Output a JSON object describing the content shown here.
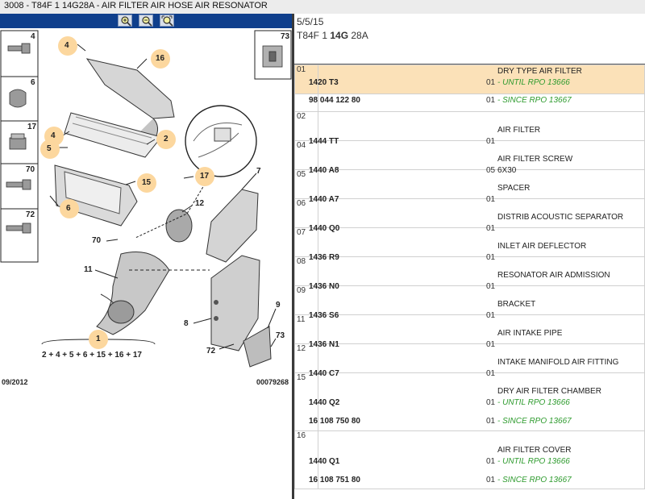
{
  "window": {
    "title": "3008 - T84F 1 14G28A - AIR FILTER AIR HOSE AIR RESONATOR"
  },
  "toolbar": {
    "buttons": [
      "zoom-in-icon",
      "zoom-out-icon",
      "zoom-fit-icon"
    ]
  },
  "header": {
    "date": "5/5/15",
    "code_prefix": "T84F 1 ",
    "code_bold": "14G",
    "code_suffix": " 28A"
  },
  "diagram": {
    "date": "09/2012",
    "ref": "00079268",
    "formula": "2 + 4 + 5 + 6 + 15 + 16 + 17",
    "side_labels": [
      "4",
      "6",
      "17",
      "70",
      "72"
    ],
    "side_right_label": "73",
    "callouts": [
      "4",
      "16",
      "2",
      "4",
      "5",
      "15",
      "6",
      "17",
      "7",
      "12",
      "70",
      "11",
      "8",
      "9",
      "73",
      "72",
      "1"
    ]
  },
  "rows": [
    {
      "item": "01",
      "selected": true,
      "lines": [
        {
          "ref": "1420 T3",
          "qty": "01",
          "desc": "DRY TYPE AIR FILTER",
          "note": "- UNTIL RPO 13666"
        },
        {
          "ref": "98 044 122 80",
          "qty": "01",
          "desc": "",
          "note": "- SINCE RPO 13667"
        }
      ]
    },
    {
      "item": "02",
      "lines": [
        {
          "ref": "1444 TT",
          "qty": "01",
          "desc": "AIR FILTER",
          "note": ""
        }
      ]
    },
    {
      "item": "04",
      "lines": [
        {
          "ref": "1440 A8",
          "qty": "05",
          "desc": "AIR FILTER SCREW",
          "note2": "6X30"
        }
      ]
    },
    {
      "item": "05",
      "lines": [
        {
          "ref": "1440 A7",
          "qty": "01",
          "desc": "SPACER",
          "note": ""
        }
      ]
    },
    {
      "item": "06",
      "lines": [
        {
          "ref": "1440 Q0",
          "qty": "01",
          "desc": "DISTRIB ACOUSTIC SEPARATOR",
          "note": ""
        }
      ]
    },
    {
      "item": "07",
      "lines": [
        {
          "ref": "1436 R9",
          "qty": "01",
          "desc": "INLET AIR DEFLECTOR",
          "note": ""
        }
      ]
    },
    {
      "item": "08",
      "lines": [
        {
          "ref": "1436 N0",
          "qty": "01",
          "desc": "RESONATOR AIR ADMISSION",
          "note": ""
        }
      ]
    },
    {
      "item": "09",
      "lines": [
        {
          "ref": "1436 S6",
          "qty": "01",
          "desc": "BRACKET",
          "note": ""
        }
      ]
    },
    {
      "item": "11",
      "lines": [
        {
          "ref": "1436 N1",
          "qty": "01",
          "desc": "AIR INTAKE PIPE",
          "note": ""
        }
      ]
    },
    {
      "item": "12",
      "lines": [
        {
          "ref": "1440 C7",
          "qty": "01",
          "desc": "INTAKE MANIFOLD AIR FITTING",
          "note": ""
        }
      ]
    },
    {
      "item": "15",
      "lines": [
        {
          "ref": "1440 Q2",
          "qty": "01",
          "desc": "DRY AIR FILTER CHAMBER",
          "note": "- UNTIL RPO 13666"
        },
        {
          "ref": "16 108 750 80",
          "qty": "01",
          "desc": "",
          "note": "- SINCE RPO 13667"
        }
      ]
    },
    {
      "item": "16",
      "lines": [
        {
          "ref": "1440 Q1",
          "qty": "01",
          "desc": "AIR FILTER COVER",
          "note": "- UNTIL RPO 13666"
        },
        {
          "ref": "16 108 751 80",
          "qty": "01",
          "desc": "",
          "note": "- SINCE RPO 13667"
        }
      ]
    }
  ]
}
